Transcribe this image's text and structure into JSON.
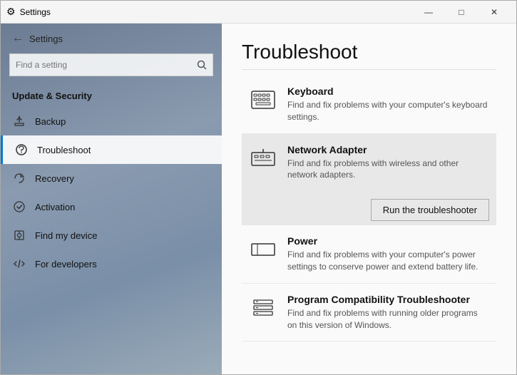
{
  "window": {
    "title": "Settings"
  },
  "titlebar": {
    "title": "Settings",
    "minimize_label": "—",
    "maximize_label": "□",
    "close_label": "✕"
  },
  "sidebar": {
    "back_label": "Settings",
    "search_placeholder": "Find a setting",
    "section_label": "Update & Security",
    "nav_items": [
      {
        "id": "backup",
        "label": "Backup",
        "icon": "backup"
      },
      {
        "id": "troubleshoot",
        "label": "Troubleshoot",
        "icon": "troubleshoot",
        "active": true
      },
      {
        "id": "recovery",
        "label": "Recovery",
        "icon": "recovery"
      },
      {
        "id": "activation",
        "label": "Activation",
        "icon": "activation"
      },
      {
        "id": "find-my-device",
        "label": "Find my device",
        "icon": "find-device"
      },
      {
        "id": "for-developers",
        "label": "For developers",
        "icon": "developers"
      }
    ]
  },
  "main": {
    "title": "Troubleshoot",
    "items": [
      {
        "id": "keyboard",
        "title": "Keyboard",
        "description": "Find and fix problems with your computer's keyboard settings.",
        "highlighted": false
      },
      {
        "id": "network-adapter",
        "title": "Network Adapter",
        "description": "Find and fix problems with wireless and other network adapters.",
        "highlighted": true
      },
      {
        "id": "power",
        "title": "Power",
        "description": "Find and fix problems with your computer's power settings to conserve power and extend battery life.",
        "highlighted": false
      },
      {
        "id": "program-compatibility",
        "title": "Program Compatibility Troubleshooter",
        "description": "Find and fix problems with running older programs on this version of Windows.",
        "highlighted": false
      }
    ],
    "run_button_label": "Run the troubleshooter"
  }
}
